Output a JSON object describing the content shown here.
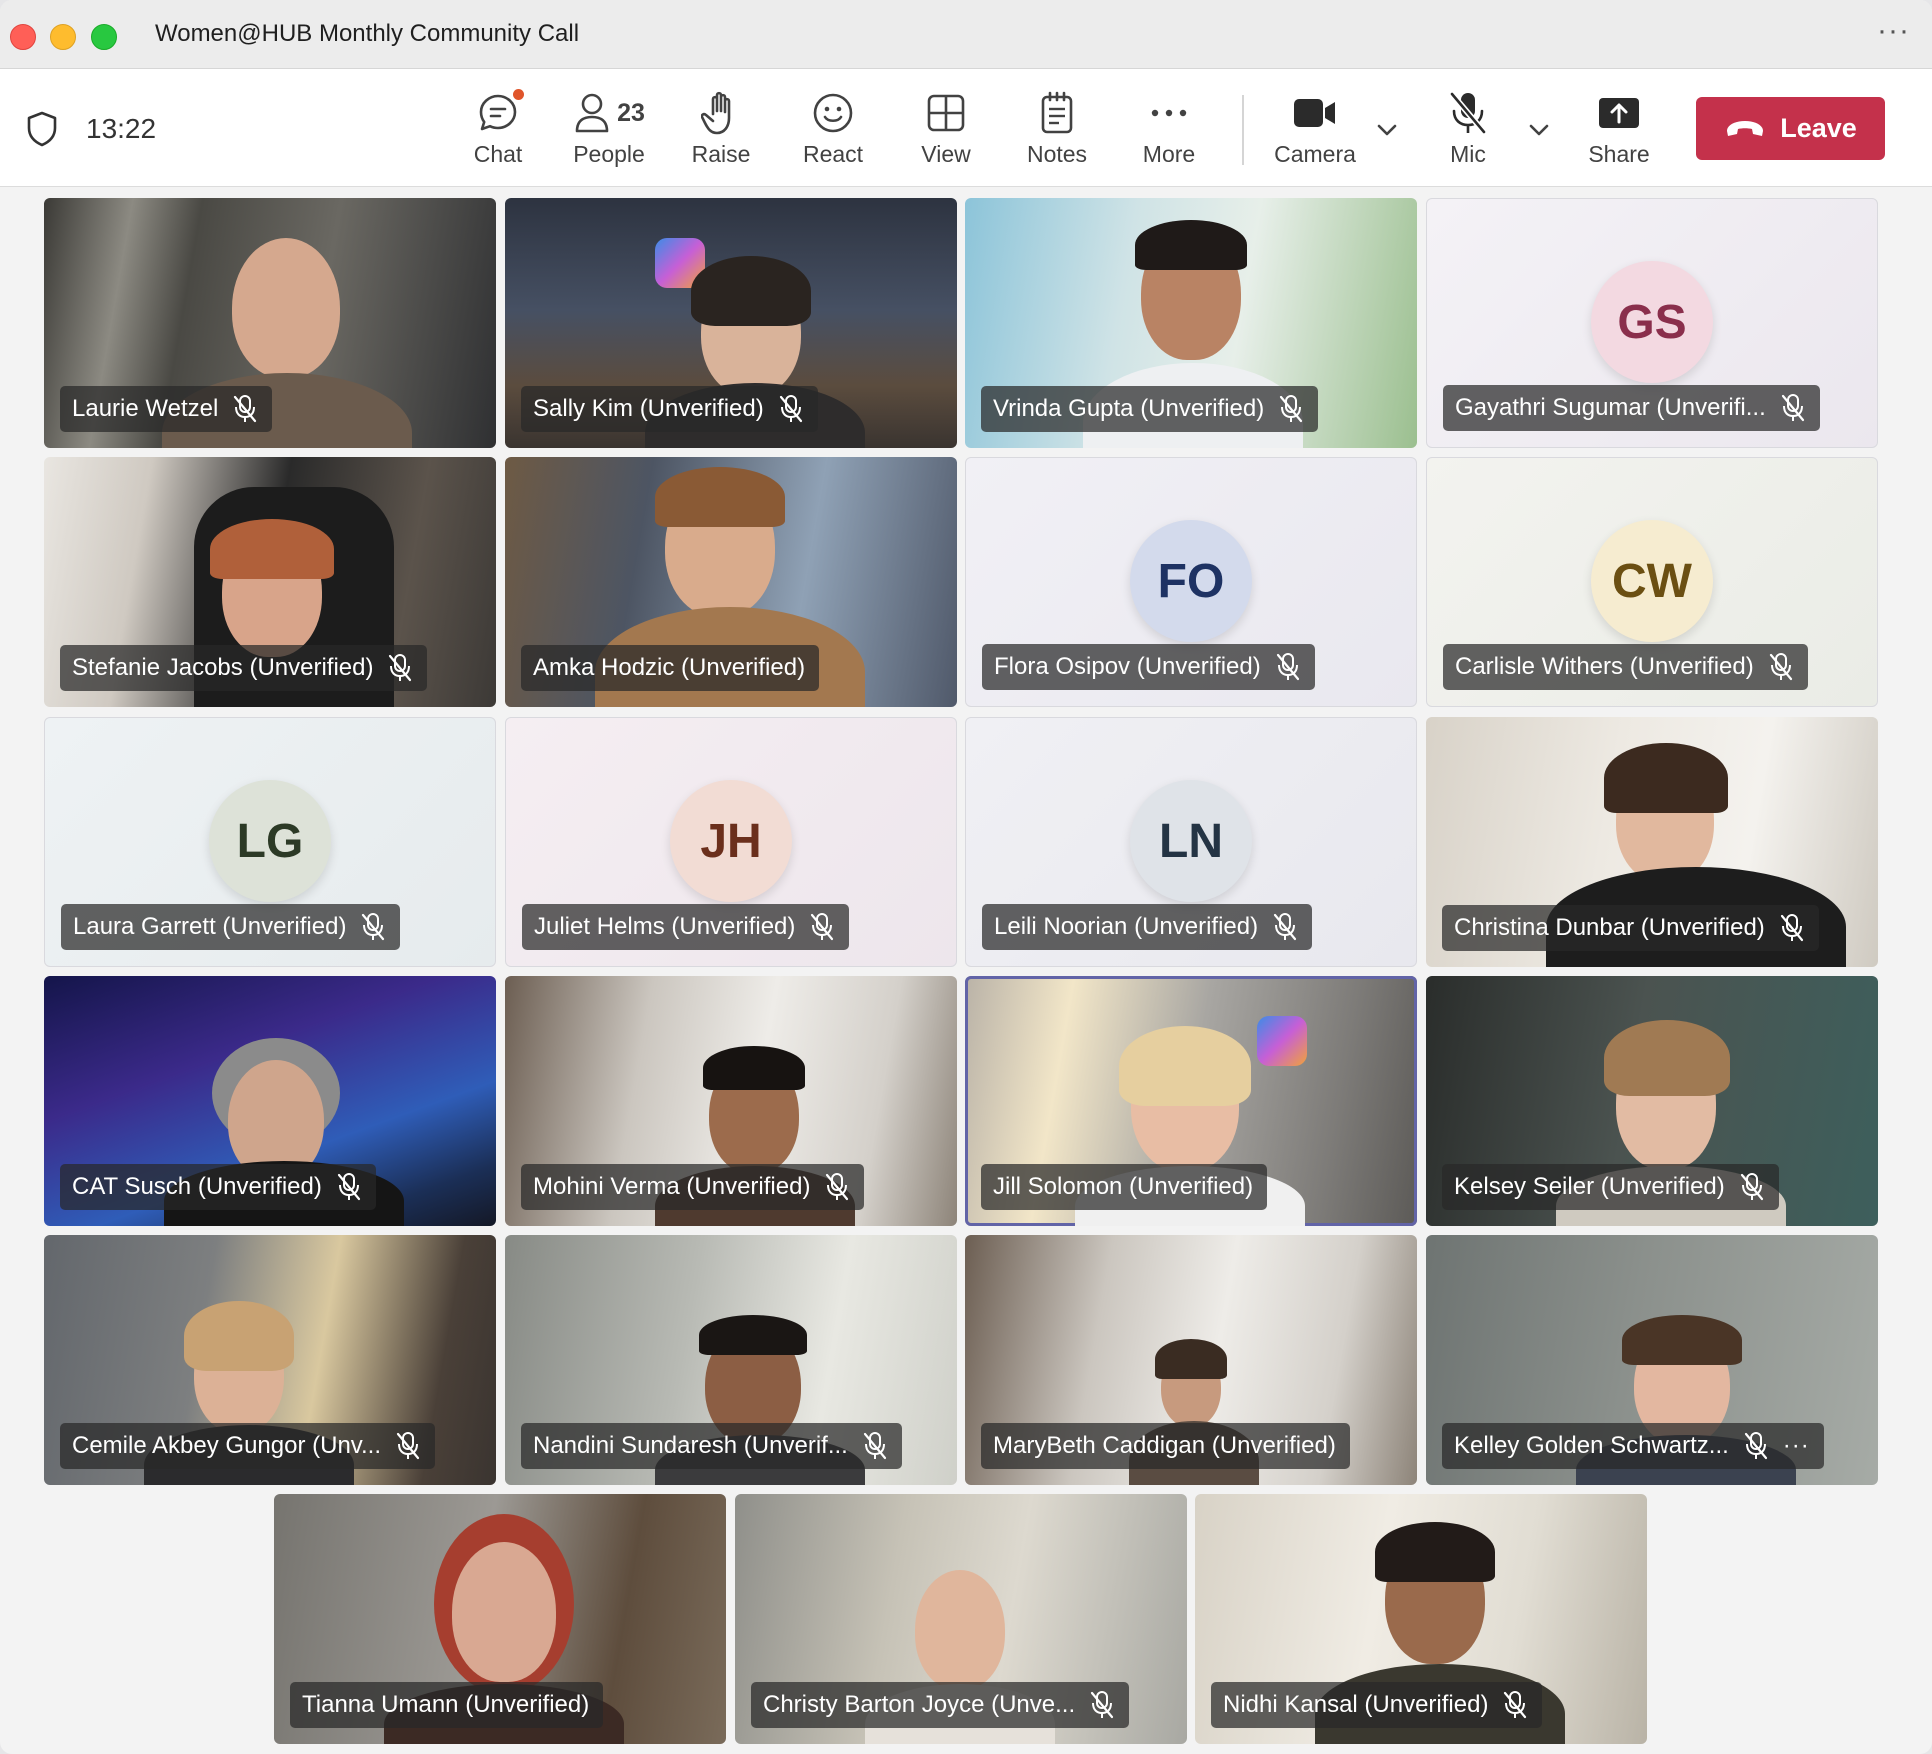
{
  "window": {
    "title": "Women@HUB Monthly Community Call"
  },
  "toolbar": {
    "time": "13:22",
    "chat_label": "Chat",
    "people_label": "People",
    "people_count": "23",
    "raise_label": "Raise",
    "react_label": "React",
    "view_label": "View",
    "notes_label": "Notes",
    "more_label": "More",
    "camera_label": "Camera",
    "mic_label": "Mic",
    "share_label": "Share",
    "leave_label": "Leave"
  },
  "participants": [
    {
      "name": "Laurie Wetzel",
      "muted": true
    },
    {
      "name": "Sally Kim (Unverified)",
      "muted": true
    },
    {
      "name": "Vrinda Gupta (Unverified)",
      "muted": true
    },
    {
      "name": "Gayathri Sugumar (Unverifi...",
      "muted": true,
      "initials": "GS"
    },
    {
      "name": "Stefanie Jacobs (Unverified)",
      "muted": true
    },
    {
      "name": "Amka Hodzic (Unverified)",
      "muted": false
    },
    {
      "name": "Flora Osipov (Unverified)",
      "muted": true,
      "initials": "FO"
    },
    {
      "name": "Carlisle Withers (Unverified)",
      "muted": true,
      "initials": "CW"
    },
    {
      "name": "Laura Garrett (Unverified)",
      "muted": true,
      "initials": "LG"
    },
    {
      "name": "Juliet Helms (Unverified)",
      "muted": true,
      "initials": "JH"
    },
    {
      "name": "Leili Noorian (Unverified)",
      "muted": true,
      "initials": "LN"
    },
    {
      "name": "Christina Dunbar (Unverified)",
      "muted": true
    },
    {
      "name": "CAT Susch (Unverified)",
      "muted": true
    },
    {
      "name": "Mohini Verma (Unverified)",
      "muted": true
    },
    {
      "name": "Jill Solomon (Unverified)",
      "muted": false,
      "speaking": true
    },
    {
      "name": "Kelsey Seiler (Unverified)",
      "muted": true
    },
    {
      "name": "Cemile Akbey Gungor (Unv...",
      "muted": true
    },
    {
      "name": "Nandini Sundaresh (Unverif...",
      "muted": true
    },
    {
      "name": "MaryBeth Caddigan (Unverified)",
      "muted": false
    },
    {
      "name": "Kelley Golden Schwartz...",
      "muted": true,
      "more": true
    },
    {
      "name": "Tianna Umann (Unverified)",
      "muted": false
    },
    {
      "name": "Christy Barton Joyce (Unve...",
      "muted": true
    },
    {
      "name": "Nidhi Kansal (Unverified)",
      "muted": true
    }
  ],
  "colors": {
    "leave": "#c4314b",
    "active_speaker": "#6264a7",
    "chat_badge": "#e0552b"
  }
}
